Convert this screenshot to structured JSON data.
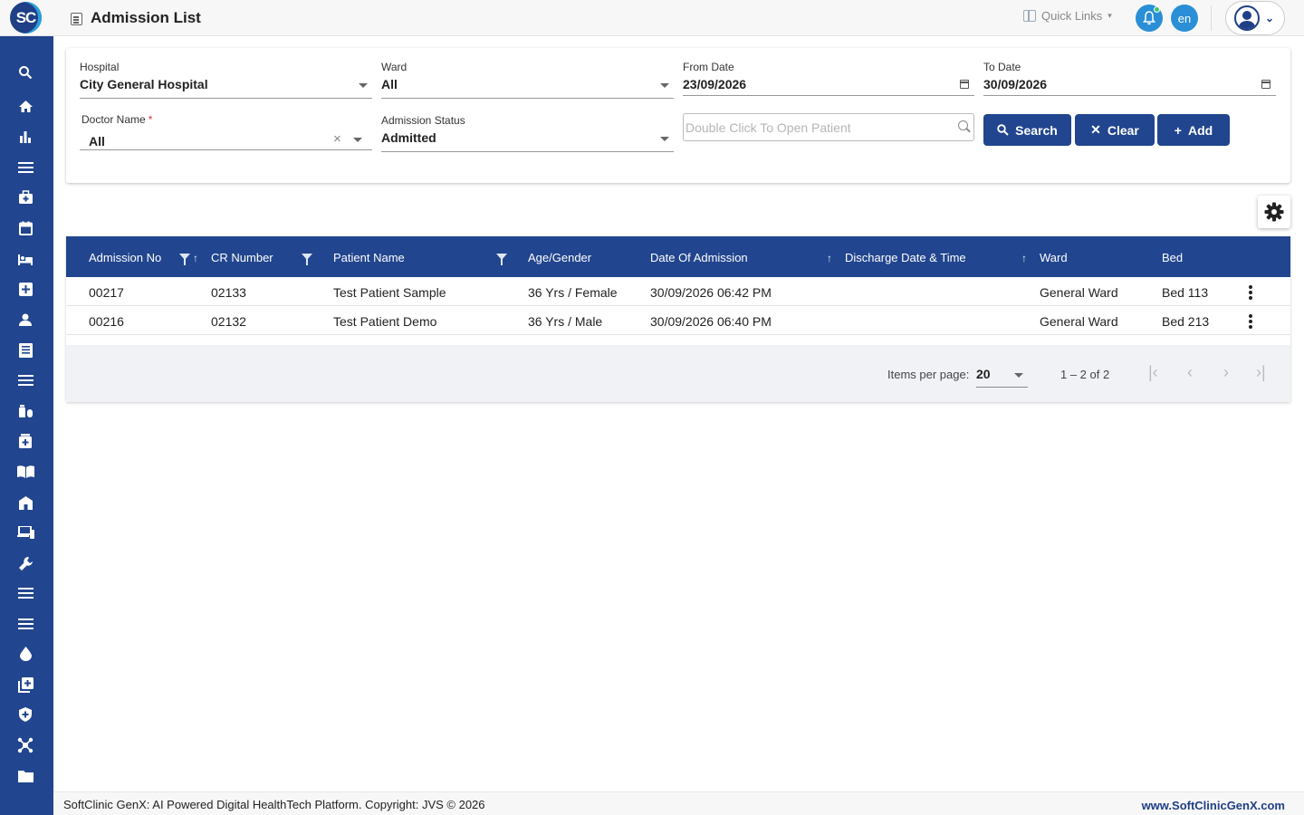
{
  "app": {
    "logo_text": "SC",
    "page_title": "Admission List"
  },
  "topbar": {
    "quick_links": "Quick Links",
    "language": "en"
  },
  "sidebar": {
    "icons": [
      "search-icon",
      "home-icon",
      "bar-chart-icon",
      "menu-icon",
      "medical-bag-icon",
      "calendar-icon",
      "bed-icon",
      "plus-box-icon",
      "person-icon",
      "document-list-icon",
      "menu-icon",
      "medication-icon",
      "medical-kit-icon",
      "book-icon",
      "hospital-building-icon",
      "devices-icon",
      "wrench-icon",
      "menu-icon",
      "menu-icon",
      "blood-drop-icon",
      "add-box-icon",
      "shield-icon",
      "network-icon",
      "folder-icon"
    ]
  },
  "filters": {
    "hospital": {
      "label": "Hospital",
      "value": "City General Hospital"
    },
    "ward": {
      "label": "Ward",
      "value": "All"
    },
    "from_date": {
      "label": "From Date",
      "value": "23/09/2026"
    },
    "to_date": {
      "label": "To Date",
      "value": "30/09/2026"
    },
    "doctor": {
      "label": "Doctor Name",
      "required_mark": "*",
      "value": "All"
    },
    "status": {
      "label": "Admission Status",
      "value": "Admitted"
    },
    "patient_search": {
      "placeholder": "Double Click To Open Patient"
    },
    "buttons": {
      "search": "Search",
      "clear": "Clear",
      "add": "Add"
    }
  },
  "table": {
    "columns": [
      "Admission No",
      "CR Number",
      "Patient Name",
      "Age/Gender",
      "Date Of Admission",
      "Discharge Date & Time",
      "Ward",
      "Bed"
    ],
    "rows": [
      [
        "00217",
        "02133",
        "Test Patient Sample",
        "36 Yrs / Female",
        "30/09/2026 06:42 PM",
        "",
        "General Ward",
        "Bed 113"
      ],
      [
        "00216",
        "02132",
        "Test Patient Demo",
        "36 Yrs / Male",
        "30/09/2026 06:40 PM",
        "",
        "General Ward",
        "Bed 213"
      ]
    ]
  },
  "pagination": {
    "items_per_page_label": "Items per page:",
    "items_per_page": "20",
    "range": "1 – 2 of 2"
  },
  "footer": {
    "left": "SoftClinic GenX: AI Powered Digital HealthTech Platform. Copyright: JVS © 2026",
    "right": "www.SoftClinicGenX.com"
  },
  "colors": {
    "primary": "#21458e",
    "accent": "#2a8fd6",
    "status_dot": "#3cc36a"
  }
}
